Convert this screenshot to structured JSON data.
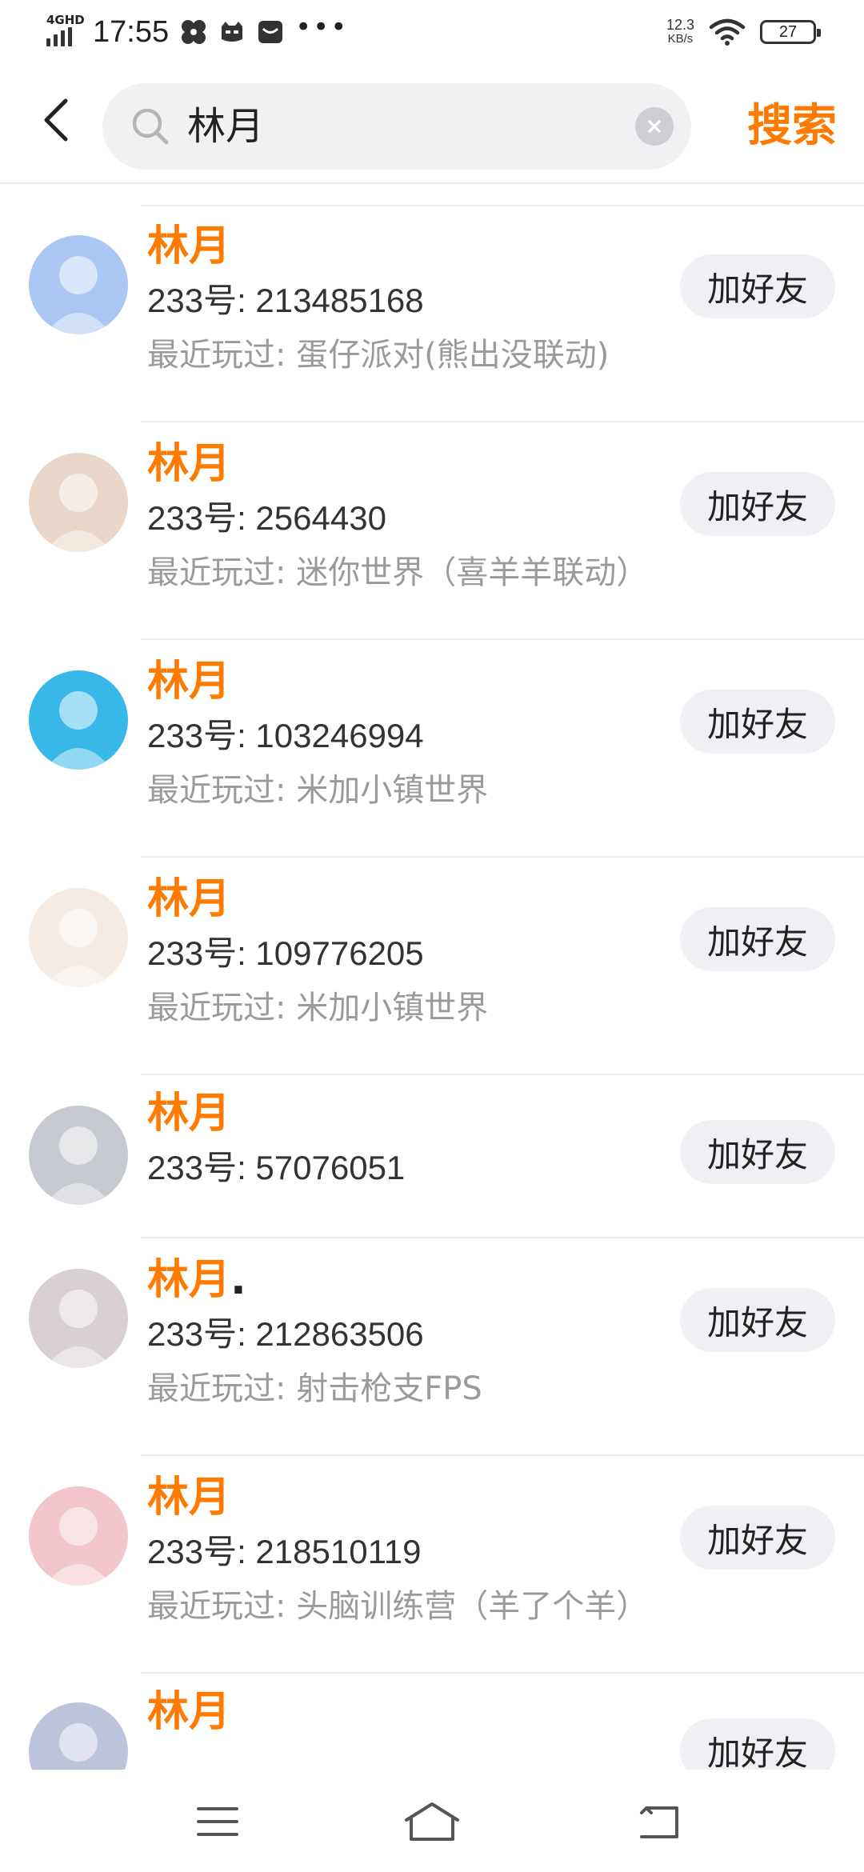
{
  "status_bar": {
    "network": "4GHD",
    "time": "17:55",
    "speed_value": "12.3",
    "speed_unit": "KB/s",
    "battery": "27",
    "more": "•••"
  },
  "search": {
    "query": "林月",
    "submit_label": "搜索"
  },
  "results": [
    {
      "name": "林月",
      "uid": "233号: 213485168",
      "played": "最近玩过: 蛋仔派对(熊出没联动)",
      "action": "加好友",
      "avatar_color": "#a9c7f2"
    },
    {
      "name": "林月",
      "uid": "233号: 2564430",
      "played": "最近玩过: 迷你世界（喜羊羊联动）",
      "action": "加好友",
      "avatar_color": "#e8d7c8"
    },
    {
      "name": "林月",
      "uid": "233号: 103246994",
      "played": "最近玩过: 米加小镇世界",
      "action": "加好友",
      "avatar_color": "#38b8e8"
    },
    {
      "name": "林月",
      "uid": "233号: 109776205",
      "played": "最近玩过: 米加小镇世界",
      "action": "加好友",
      "avatar_color": "#f4ece4"
    },
    {
      "name": "林月",
      "uid": "233号: 57076051",
      "played": "",
      "action": "加好友",
      "avatar_color": "#c6c9cf"
    },
    {
      "name": "林月",
      "name_suffix": ".",
      "uid": "233号: 212863506",
      "played": "最近玩过: 射击枪支FPS",
      "action": "加好友",
      "avatar_color": "#d9d0d6"
    },
    {
      "name": "林月",
      "uid": "233号: 218510119",
      "played": "最近玩过: 头脑训练营（羊了个羊）",
      "action": "加好友",
      "avatar_color": "#f2c6cc"
    },
    {
      "name": "林月",
      "uid": "",
      "played": "",
      "action": "加好友",
      "avatar_color": "#bcc3da"
    }
  ],
  "nav": {
    "menu_icon": "menu-icon",
    "home_icon": "home-icon",
    "back_icon": "back-icon"
  },
  "colors": {
    "accent": "#ff7a00",
    "button_bg": "#eef0f4",
    "secondary_text": "#9a9a9a"
  }
}
